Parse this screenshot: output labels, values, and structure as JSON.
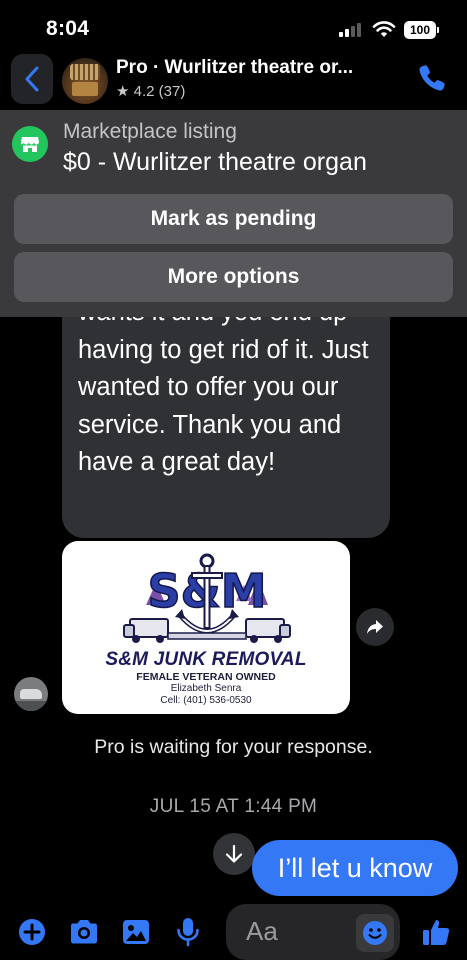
{
  "status_bar": {
    "time": "8:04",
    "battery": "100"
  },
  "header": {
    "contact_name": "Pro · Wurlitzer theatre or...",
    "rating": "★ 4.2 (37)",
    "back_icon": "chevron-left-icon",
    "call_icon": "phone-icon"
  },
  "listing": {
    "label": "Marketplace listing",
    "title": "$0 - Wurlitzer theatre organ",
    "icon": "storefront-icon",
    "mark_pending_label": "Mark as pending",
    "more_options_label": "More options"
  },
  "messages": {
    "received_text": "wants it and you end up having to get rid of it. Just wanted to offer you our service. Thank you and have a great day!",
    "card": {
      "logo_letters": "S&M",
      "company": "S&M JUNK REMOVAL",
      "tagline": "FEMALE VETERAN OWNED",
      "person": "Elizabeth Senra",
      "phone": "Cell: (401) 536-0530"
    },
    "waiting_notice": "Pro is waiting for your response.",
    "timestamp": "JUL 15 AT 1:44 PM",
    "sent_text": "I’ll let u know"
  },
  "composer": {
    "placeholder": "Aa",
    "icons": [
      "plus-icon",
      "camera-icon",
      "image-icon",
      "microphone-icon",
      "emoji-icon",
      "thumbs-up-icon"
    ]
  },
  "colors": {
    "accent": "#3478f6",
    "marketplace_green": "#22c55e",
    "received_bubble": "#303134",
    "overlay_bg": "#3a3a3c"
  }
}
